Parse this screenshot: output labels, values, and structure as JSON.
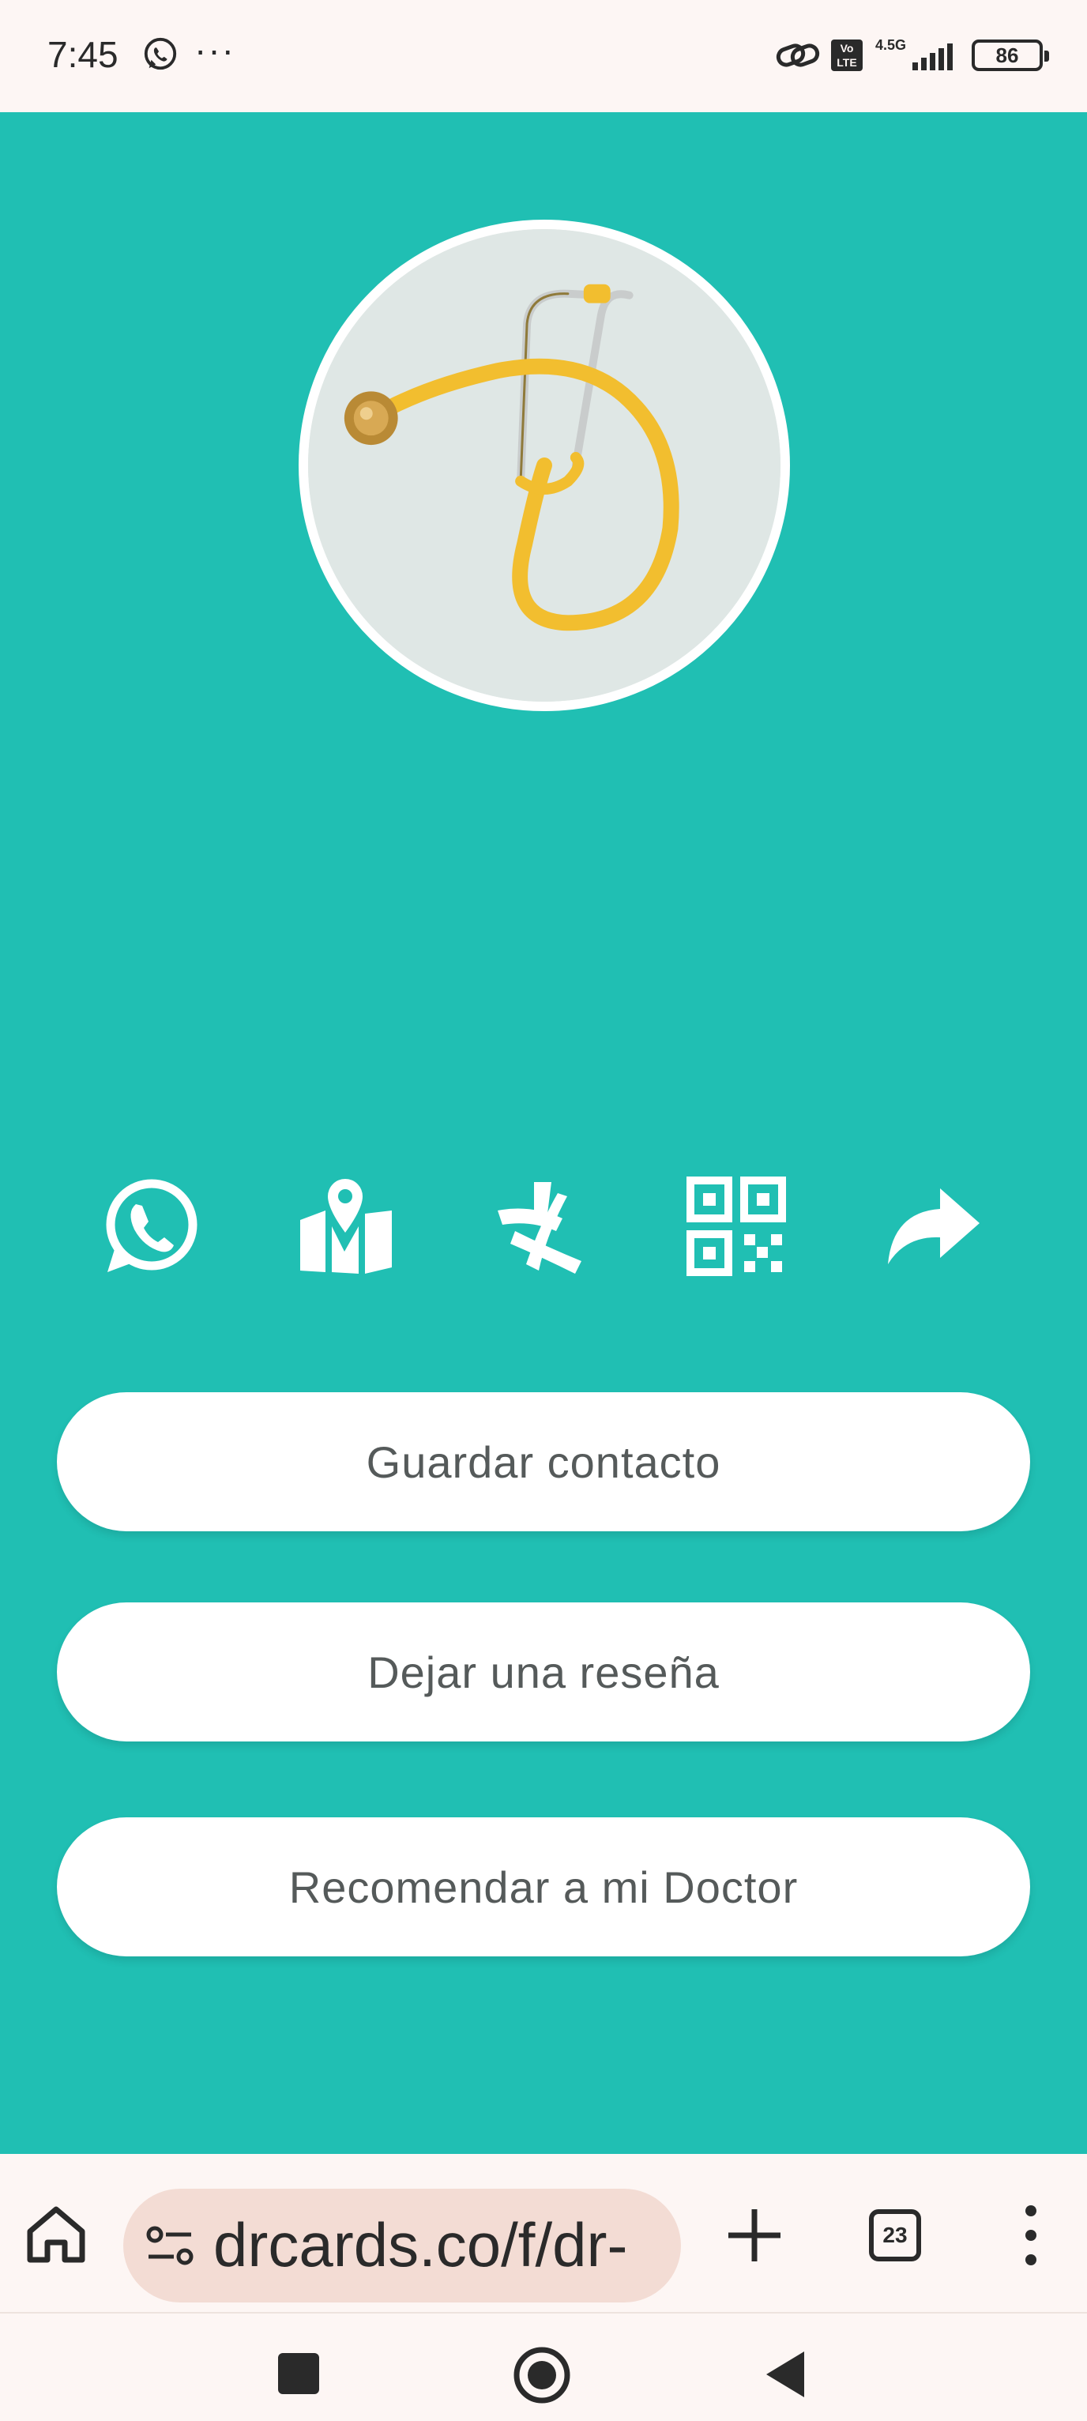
{
  "status_bar": {
    "time": "7:45",
    "dots": "···",
    "volte": "Vo LTE",
    "network": "4.5G",
    "battery": "86",
    "icons": [
      "whatsapp-icon",
      "link-icon",
      "volte-icon",
      "signal-icon",
      "battery-icon"
    ]
  },
  "profile": {
    "avatar_alt": "stethoscope"
  },
  "actions": {
    "icons": [
      "whatsapp-icon",
      "map-icon",
      "doctoralia-icon",
      "qr-code-icon",
      "share-icon"
    ]
  },
  "buttons": {
    "save_contact": "Guardar contacto",
    "leave_review": "Dejar una reseña",
    "recommend": "Recomendar a mi Doctor"
  },
  "browser": {
    "url": "drcards.co/f/dr-",
    "tab_count": "23",
    "icons": [
      "home-icon",
      "site-settings-icon",
      "new-tab-icon",
      "tabs-icon",
      "menu-icon"
    ]
  },
  "system_nav": {
    "icons": [
      "recents-icon",
      "home-circle-icon",
      "back-icon"
    ]
  },
  "colors": {
    "background_teal": "#20bfb3",
    "button_bg": "#ffffff",
    "button_text": "#555a5a",
    "chrome_bg": "#fdf6f4",
    "url_pill": "#f3dcd4",
    "stethoscope_tube": "#f2be2f"
  }
}
